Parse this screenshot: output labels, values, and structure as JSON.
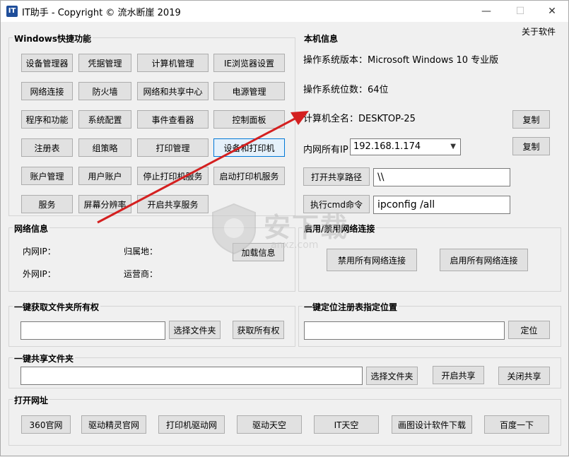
{
  "window": {
    "title": "IT助手 - Copyright © 流水断崖 2019",
    "icon_text": "IT",
    "minimize": "—",
    "maximize": "☐",
    "close": "✕"
  },
  "menu": {
    "about": "关于软件"
  },
  "shortcuts": {
    "title": "Windows快捷功能",
    "buttons": [
      "设备管理器",
      "凭据管理",
      "计算机管理",
      "IE浏览器设置",
      "网络连接",
      "防火墙",
      "网络和共享中心",
      "电源管理",
      "程序和功能",
      "系统配置",
      "事件查看器",
      "控制面板",
      "注册表",
      "组策略",
      "打印管理",
      "设备和打印机",
      "账户管理",
      "用户账户",
      "停止打印机服务",
      "启动打印机服务",
      "服务",
      "屏幕分辨率",
      "开启共享服务"
    ]
  },
  "machine_info": {
    "title": "本机信息",
    "os_version": "操作系统版本：Microsoft Windows 10 专业版",
    "os_bits": "操作系统位数：64位",
    "computer_name": "计算机全名：DESKTOP-25",
    "copy_name_button": "复制",
    "lan_ip_label": "内网所有IP：",
    "lan_ip_value": "192.168.1.174",
    "copy_ip_button": "复制",
    "open_share_button": "打开共享路径",
    "share_path_value": "\\\\",
    "run_cmd_button": "执行cmd命令",
    "cmd_value": "ipconfig /all"
  },
  "network_info": {
    "title": "网络信息",
    "lan_ip_label": "内网IP：",
    "location_label": "归属地：",
    "wan_ip_label": "外网IP：",
    "isp_label": "运营商：",
    "load_button": "加载信息"
  },
  "network_toggle": {
    "title": "启用/禁用网络连接",
    "disable_button": "禁用所有网络连接",
    "enable_button": "启用所有网络连接"
  },
  "ownership": {
    "title": "一键获取文件夹所有权",
    "path_value": "",
    "choose_button": "选择文件夹",
    "take_button": "获取所有权"
  },
  "registry": {
    "title": "一键定位注册表指定位置",
    "path_value": "",
    "locate_button": "定位"
  },
  "share_folder": {
    "title": "一键共享文件夹",
    "path_value": "",
    "choose_button": "选择文件夹",
    "open_button": "开启共享",
    "close_button": "关闭共享"
  },
  "open_url": {
    "title": "打开网址",
    "buttons": [
      "360官网",
      "驱动精灵官网",
      "打印机驱动网",
      "驱动天空",
      "IT天空",
      "画图设计软件下载",
      "百度一下"
    ]
  },
  "watermark": {
    "main": "安下载",
    "sub": "anxz.com"
  },
  "colors": {
    "arrow": "#d42020",
    "focus": "#0078d7"
  }
}
